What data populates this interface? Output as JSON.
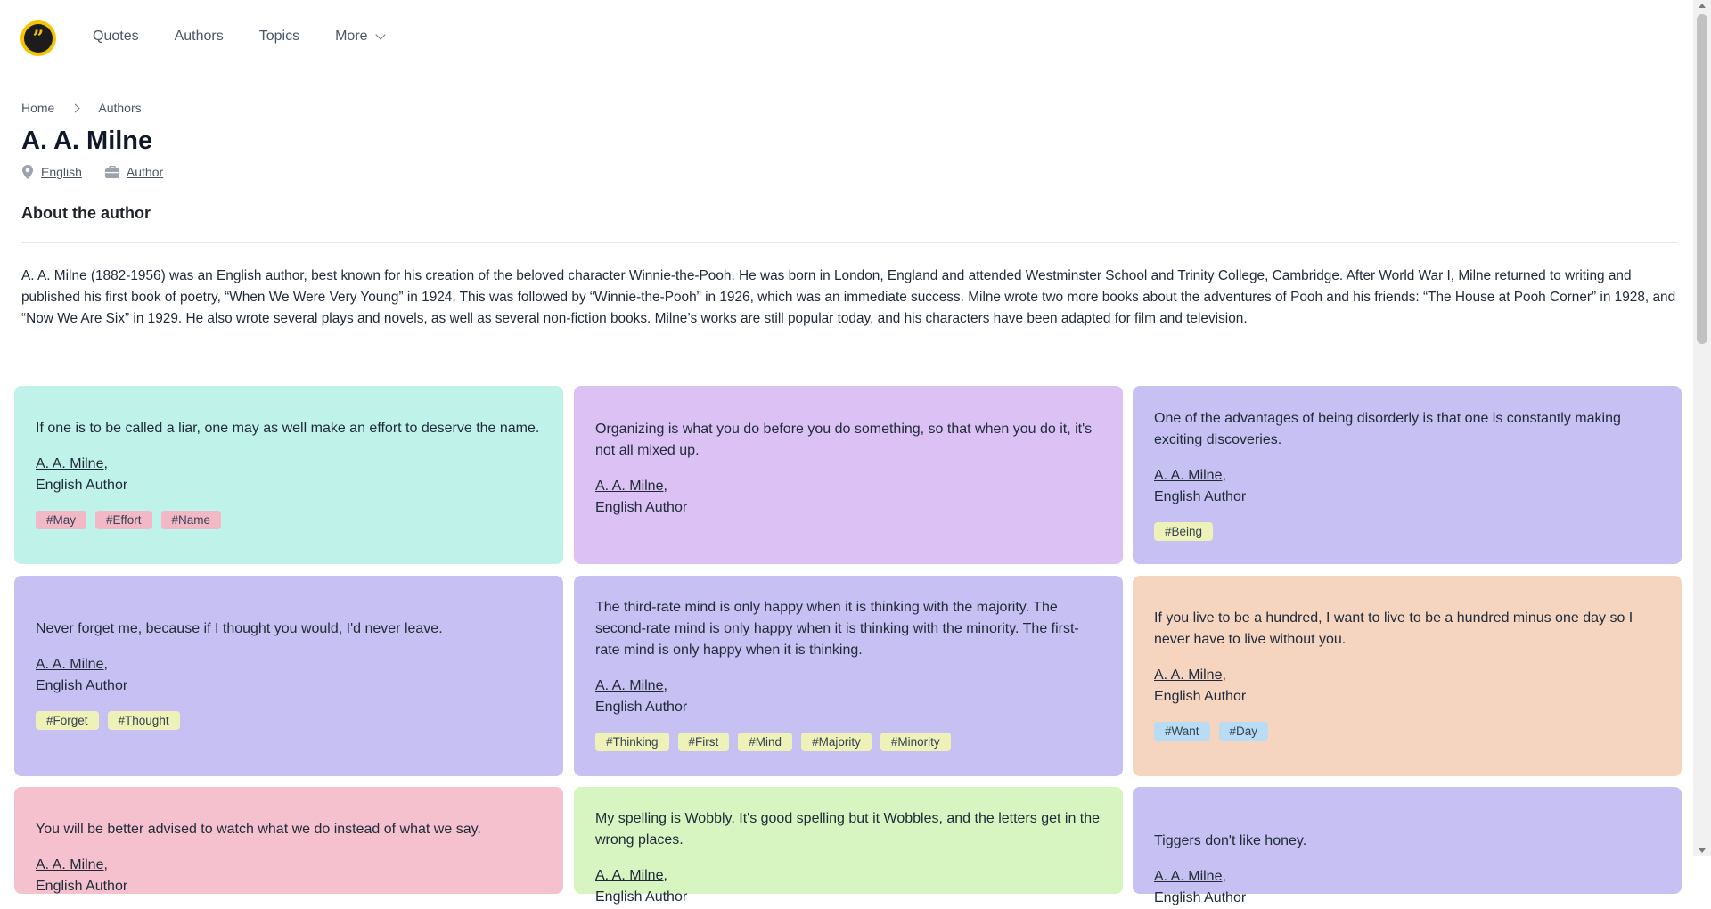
{
  "nav": {
    "items": [
      "Quotes",
      "Authors",
      "Topics",
      "More"
    ]
  },
  "breadcrumb": {
    "home": "Home",
    "current": "Authors"
  },
  "author": {
    "name": "A. A. Milne",
    "nationality": "English",
    "profession": "Author"
  },
  "about": {
    "heading": "About the author",
    "bio": "A. A. Milne (1882-1956) was an English author, best known for his creation of the beloved character Winnie-the-Pooh. He was born in London, England and attended Westminster School and Trinity College, Cambridge. After World War I, Milne returned to writing and published his first book of poetry, “When We Were Very Young” in 1924. This was followed by “Winnie-the-Pooh” in 1926, which was an immediate success. Milne wrote two more books about the adventures of Pooh and his friends: “The House at Pooh Corner” in 1928, and “Now We Are Six” in 1929. He also wrote several plays and novels, as well as several non-fiction books. Milne’s works are still popular today, and his characters have been adapted for film and television."
  },
  "quotes": [
    {
      "text": "If one is to be called a liar, one may as well make an effort to deserve the name.",
      "author": "A. A. Milne",
      "role": "English Author",
      "tags": [
        "#May",
        "#Effort",
        "#Name"
      ]
    },
    {
      "text": "Organizing is what you do before you do something, so that when you do it, it's not all mixed up.",
      "author": "A. A. Milne",
      "role": "English Author",
      "tags": []
    },
    {
      "text": "One of the advantages of being disorderly is that one is constantly making exciting discoveries.",
      "author": "A. A. Milne",
      "role": "English Author",
      "tags": [
        "#Being"
      ]
    },
    {
      "text": "Never forget me, because if I thought you would, I'd never leave.",
      "author": "A. A. Milne",
      "role": "English Author",
      "tags": [
        "#Forget",
        "#Thought"
      ]
    },
    {
      "text": "The third-rate mind is only happy when it is thinking with the majority. The second-rate mind is only happy when it is thinking with the minority. The first-rate mind is only happy when it is thinking.",
      "author": "A. A. Milne",
      "role": "English Author",
      "tags": [
        "#Thinking",
        "#First",
        "#Mind",
        "#Majority",
        "#Minority"
      ]
    },
    {
      "text": "If you live to be a hundred, I want to live to be a hundred minus one day so I never have to live without you.",
      "author": "A. A. Milne",
      "role": "English Author",
      "tags": [
        "#Want",
        "#Day"
      ]
    },
    {
      "text": "You will be better advised to watch what we do instead of what we say.",
      "author": "A. A. Milne",
      "role": "English Author",
      "tags": []
    },
    {
      "text": "My spelling is Wobbly. It's good spelling but it Wobbles, and the letters get in the wrong places.",
      "author": "A. A. Milne",
      "role": "English Author",
      "tags": []
    },
    {
      "text": "Tiggers don't like honey.",
      "author": "A. A. Milne",
      "role": "English Author",
      "tags": []
    }
  ],
  "colors": {
    "logo": "#f5c400",
    "card_teal": "#bff3e9",
    "card_purple": "#dcc1f5",
    "card_lavender": "#c7c0f3",
    "card_peach": "#f5d5c0",
    "card_pink": "#f5c1cf",
    "card_green": "#d6f5c0",
    "tag_pink": "#f3b8c6",
    "tag_yellow": "#eef2b8",
    "tag_blue": "#b8dcf3"
  },
  "icons": [
    "quote-logo-icon",
    "chevron-down-icon",
    "chevron-right-icon",
    "location-pin-icon",
    "briefcase-icon"
  ]
}
